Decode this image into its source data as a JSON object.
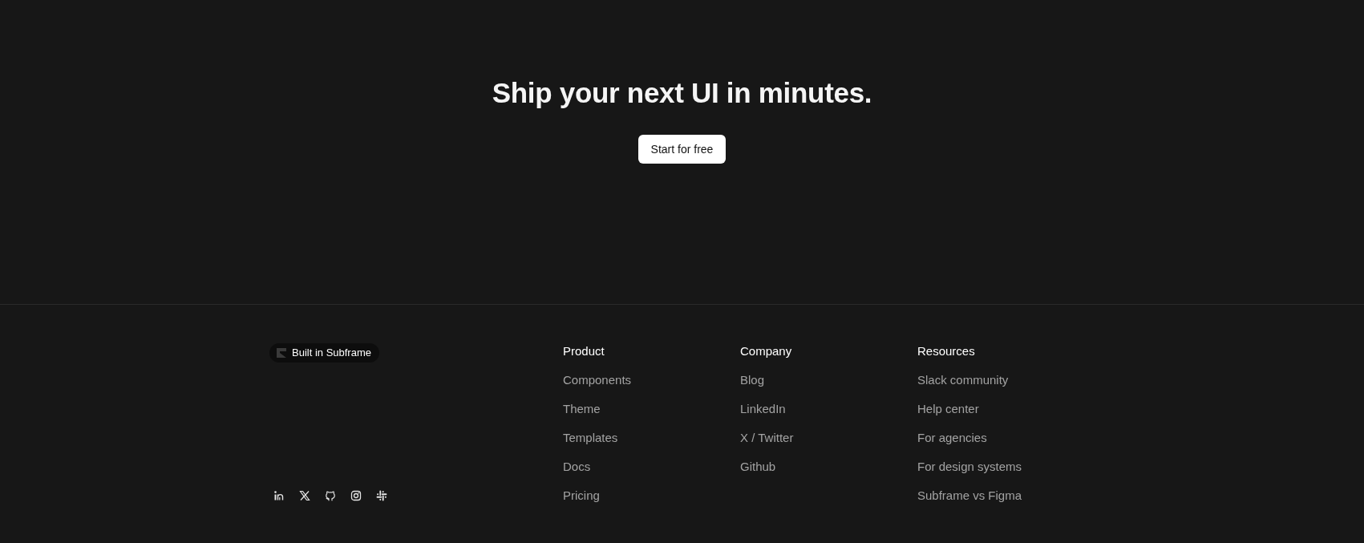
{
  "hero": {
    "heading": "Ship your next UI in minutes.",
    "button": "Start for free"
  },
  "footer": {
    "badge": "Built in Subframe",
    "social_links": [
      {
        "kind": "linkedin"
      },
      {
        "kind": "x"
      },
      {
        "kind": "github"
      },
      {
        "kind": "instagram"
      },
      {
        "kind": "slack"
      }
    ],
    "columns": [
      {
        "heading": "Product",
        "links": [
          "Components",
          "Theme",
          "Templates",
          "Docs",
          "Pricing"
        ]
      },
      {
        "heading": "Company",
        "links": [
          "Blog",
          "LinkedIn",
          "X / Twitter",
          "Github"
        ]
      },
      {
        "heading": "Resources",
        "links": [
          "Slack community",
          "Help center",
          "For agencies",
          "For design systems",
          "Subframe vs Figma"
        ]
      }
    ]
  }
}
